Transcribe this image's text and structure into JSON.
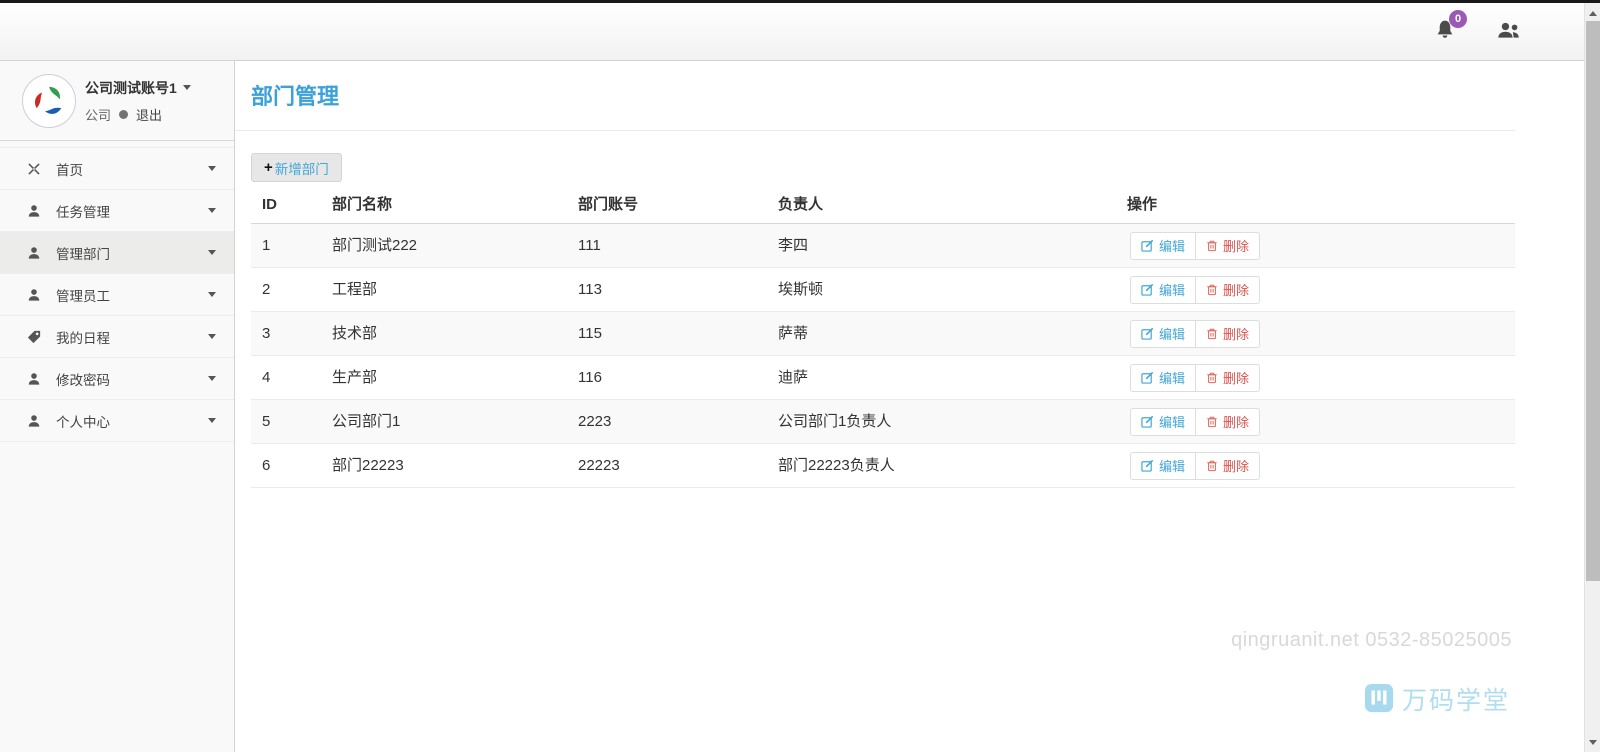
{
  "topbar": {
    "notification_count": "0"
  },
  "sidebar": {
    "user": {
      "name": "公司测试账号1",
      "org": "公司",
      "logout": "退出"
    },
    "items": [
      {
        "label": "首页"
      },
      {
        "label": "任务管理"
      },
      {
        "label": "管理部门"
      },
      {
        "label": "管理员工"
      },
      {
        "label": "我的日程"
      },
      {
        "label": "修改密码"
      },
      {
        "label": "个人中心"
      }
    ]
  },
  "main": {
    "title": "部门管理",
    "add_button": "新增部门",
    "table": {
      "headers": [
        "ID",
        "部门名称",
        "部门账号",
        "负责人",
        "操作"
      ],
      "rows": [
        {
          "id": "1",
          "name": "部门测试222",
          "account": "111",
          "manager": "李四"
        },
        {
          "id": "2",
          "name": "工程部",
          "account": "113",
          "manager": "埃斯顿"
        },
        {
          "id": "3",
          "name": "技术部",
          "account": "115",
          "manager": "萨蒂"
        },
        {
          "id": "4",
          "name": "生产部",
          "account": "116",
          "manager": "迪萨"
        },
        {
          "id": "5",
          "name": "公司部门1",
          "account": "2223",
          "manager": "公司部门1负责人"
        },
        {
          "id": "6",
          "name": "部门22223",
          "account": "22223",
          "manager": "部门22223负责人"
        }
      ],
      "edit_label": "编辑",
      "delete_label": "删除"
    },
    "watermark_text": "qingruanit.net 0532-85025005",
    "watermark_brand": "万码学堂"
  },
  "colors": {
    "accent_blue": "#3aa1d9",
    "badge_purple": "#9b59b6",
    "delete_red": "#d9534f",
    "sidebar_bg": "#f9f9f9"
  }
}
